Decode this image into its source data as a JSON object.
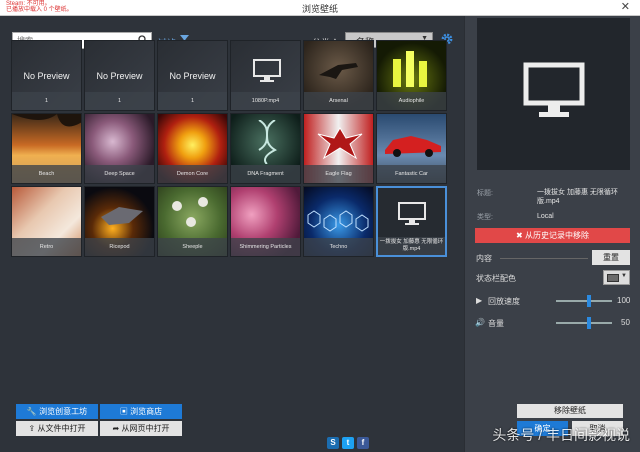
{
  "window": {
    "title": "浏览壁纸",
    "notice_line1": "Steam: 不可用。",
    "notice_line2": "已播放中载入 0 个壁纸。",
    "close_glyph": "✕"
  },
  "toolbar": {
    "search_placeholder": "搜索",
    "filter_label": "过滤",
    "sort_label": "分类",
    "sort_arrow": "▲",
    "sort_value": "名称"
  },
  "grid": {
    "tiles": [
      {
        "type": "noprev",
        "overlay": "No Preview",
        "caption": "1"
      },
      {
        "type": "noprev",
        "overlay": "No Preview",
        "caption": "1"
      },
      {
        "type": "noprev",
        "overlay": "No Preview",
        "caption": "1"
      },
      {
        "type": "monitor",
        "caption": "1080P.mp4"
      },
      {
        "type": "image",
        "caption": "Arsenal"
      },
      {
        "type": "image",
        "caption": "Audiophile"
      },
      {
        "type": "image",
        "caption": "Beach"
      },
      {
        "type": "image",
        "caption": "Deep Space"
      },
      {
        "type": "image",
        "caption": "Demon Core"
      },
      {
        "type": "image",
        "caption": "DNA Fragment"
      },
      {
        "type": "image",
        "caption": "Eagle Flag"
      },
      {
        "type": "image",
        "caption": "Fantastic Car"
      },
      {
        "type": "image",
        "caption": "Retro"
      },
      {
        "type": "image",
        "caption": "Ricepod"
      },
      {
        "type": "image",
        "caption": "Sheeple"
      },
      {
        "type": "image",
        "caption": "Shimmering Particles"
      },
      {
        "type": "image",
        "caption": "Techno"
      },
      {
        "type": "monitor",
        "caption": "一拨拔女 加藤惠 无限循环 版.mp4"
      }
    ]
  },
  "bottom": {
    "workshop_label": "浏览创意工坊",
    "store_label": "浏览商店",
    "open_file_label": "从文件中打开",
    "open_web_label": "从网页中打开",
    "remove_wallpaper_label": "移除壁纸",
    "ok_label": "确定",
    "cancel_label": "取消"
  },
  "details": {
    "title_label": "标题:",
    "title_value": "一拨拔女 加藤惠 无限循环 版.mp4",
    "type_label": "类型:",
    "type_value": "Local",
    "remove_history_label": "✖ 从历史记录中移除",
    "content_label": "内容",
    "reset_label": "重置",
    "statusbar_color_label": "状态栏配色",
    "playback_label": "回放速度",
    "playback_value": "100",
    "playback_level": 0.6,
    "volume_label": "音量",
    "volume_value": "50",
    "volume_level": 0.6
  },
  "watermark": "头条号 / 丰日间影视说"
}
